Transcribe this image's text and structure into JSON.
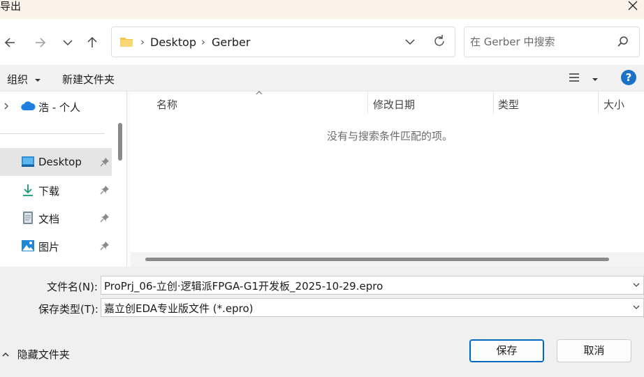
{
  "window": {
    "title": "导出"
  },
  "nav": {
    "breadcrumbs": [
      "Desktop",
      "Gerber"
    ],
    "search_placeholder": "在 Gerber 中搜索"
  },
  "toolbar": {
    "organize": "组织",
    "new_folder": "新建文件夹"
  },
  "sidebar": {
    "onedrive": "浩 - 个人",
    "items": [
      {
        "label": "Desktop",
        "icon": "desktop-icon"
      },
      {
        "label": "下载",
        "icon": "download-icon"
      },
      {
        "label": "文档",
        "icon": "document-icon"
      },
      {
        "label": "图片",
        "icon": "pictures-icon"
      }
    ]
  },
  "filelist": {
    "columns": [
      "名称",
      "修改日期",
      "类型",
      "大小"
    ],
    "empty_message": "没有与搜索条件匹配的项。"
  },
  "form": {
    "filename_label": "文件名(N):",
    "filename_value": "ProPrj_06-立创·逻辑派FPGA-G1开发板_2025-10-29.epro",
    "filetype_label": "保存类型(T):",
    "filetype_value": "嘉立创EDA专业版文件 (*.epro)"
  },
  "footer": {
    "hide_folders": "隐藏文件夹",
    "save": "保存",
    "cancel": "取消"
  },
  "colors": {
    "accent": "#0067c0",
    "help": "#1a73c9",
    "selected": "#e5e5e5"
  }
}
